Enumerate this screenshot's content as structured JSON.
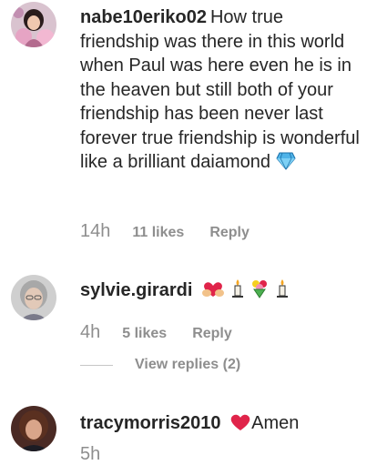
{
  "comments": [
    {
      "username": "nabe10eriko02",
      "text": "How true friendship was there in this world when Paul was here even he is in the heaven but still both of your friendship has been never last forever true friendship is wonderful like a brilliant daiamond",
      "time": "14h",
      "likes": "11 likes",
      "reply": "Reply"
    },
    {
      "username": "sylvie.girardi",
      "time": "4h",
      "likes": "5 likes",
      "reply": "Reply",
      "view_replies": "View replies (2)"
    },
    {
      "username": "tracymorris2010",
      "text": "Amen",
      "partial_time": "5h"
    }
  ],
  "icons": {
    "comment1_emoji": "gem-icon",
    "comment2_emojis": [
      "heart-hands-icon",
      "candle-icon",
      "bouquet-icon",
      "candle-icon"
    ],
    "comment3_emoji": "red-heart-icon"
  },
  "colors": {
    "text": "#262626",
    "secondary": "#8e8e8e",
    "heart": "#e0244a",
    "gem": "#4fb3e8"
  }
}
